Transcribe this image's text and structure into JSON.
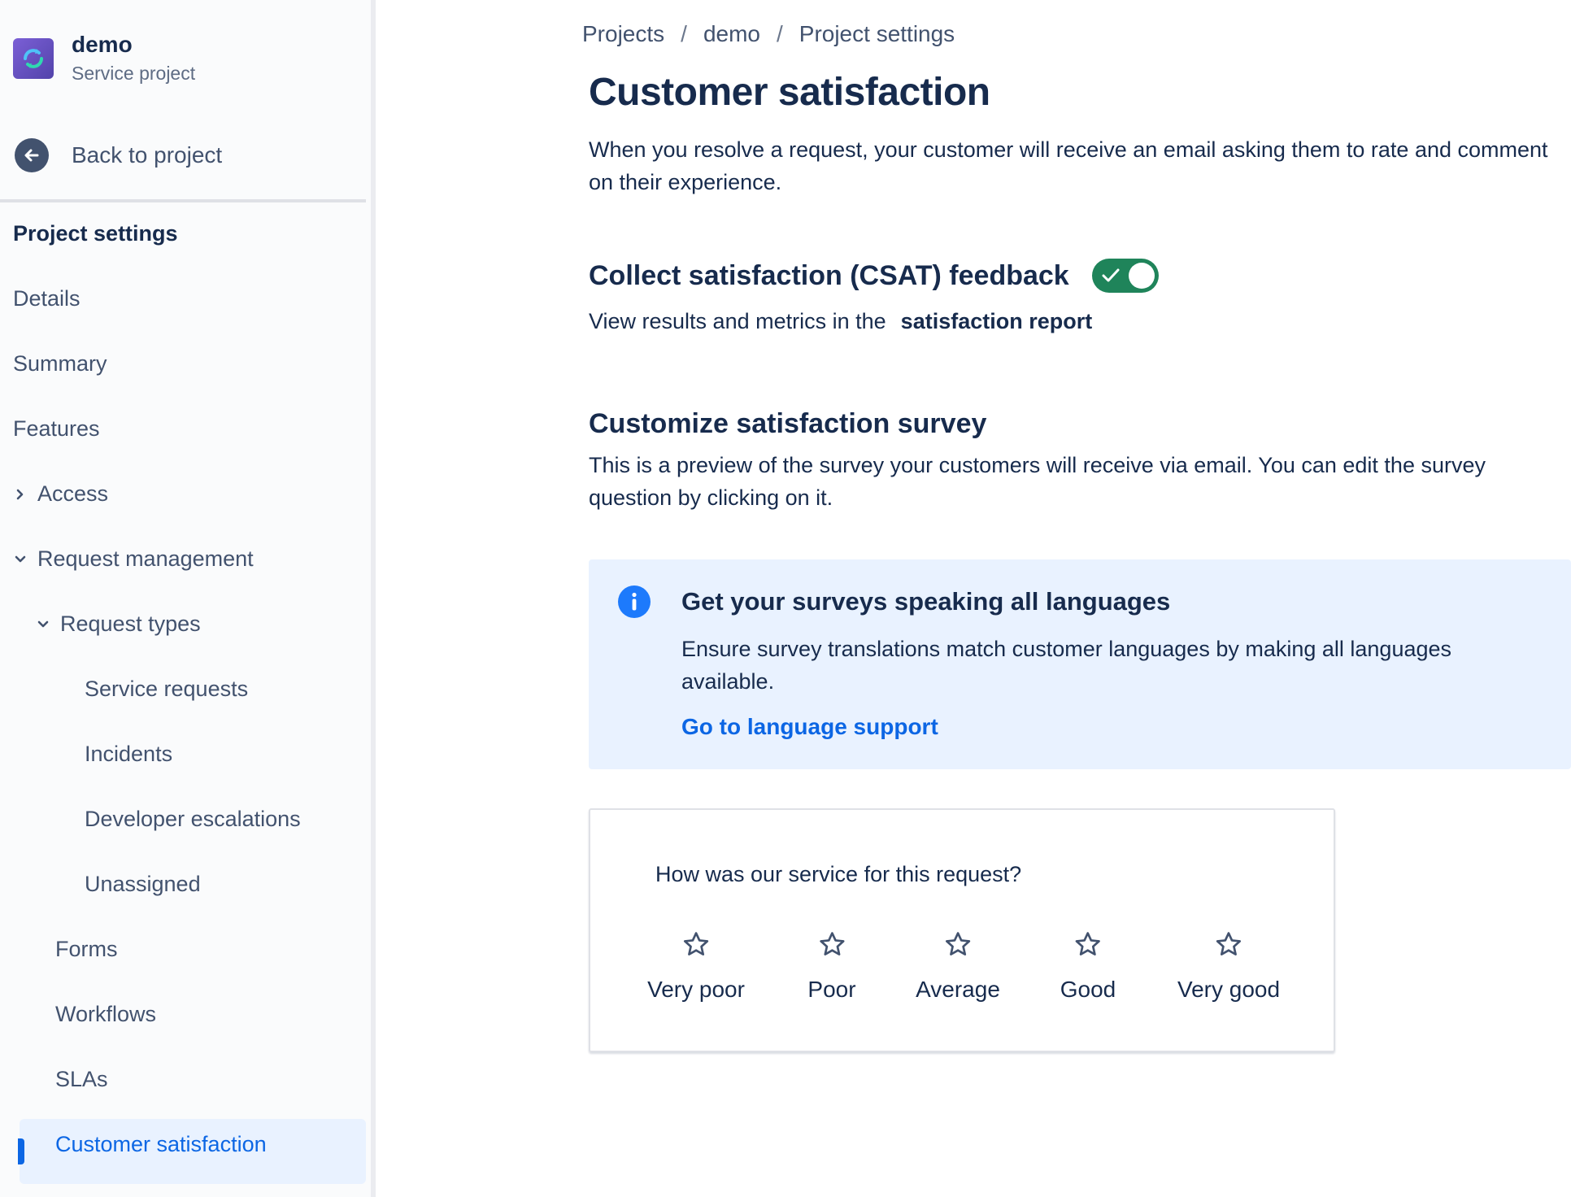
{
  "project": {
    "name": "demo",
    "type": "Service project",
    "avatar_icon": "service-project-avatar-icon"
  },
  "sidebar": {
    "back_label": "Back to project",
    "heading": "Project settings",
    "items": [
      {
        "label": "Details"
      },
      {
        "label": "Summary"
      },
      {
        "label": "Features"
      },
      {
        "label": "Access",
        "icon": "chevron-right-icon",
        "expanded": false
      },
      {
        "label": "Request management",
        "icon": "chevron-down-icon",
        "expanded": true
      },
      {
        "label": "Request types",
        "icon": "chevron-down-icon",
        "expanded": true
      },
      {
        "label": "Service requests"
      },
      {
        "label": "Incidents"
      },
      {
        "label": "Developer escalations"
      },
      {
        "label": "Unassigned"
      },
      {
        "label": "Forms"
      },
      {
        "label": "Workflows"
      },
      {
        "label": "SLAs"
      },
      {
        "label": "Customer satisfaction",
        "active": true
      }
    ]
  },
  "breadcrumb": {
    "items": [
      "Projects",
      "demo",
      "Project settings"
    ],
    "separator": "/"
  },
  "main": {
    "title": "Customer satisfaction",
    "intro": "When you resolve a request, your customer will receive an email asking them to rate and comment on their experience.",
    "csat": {
      "title": "Collect satisfaction (CSAT) feedback",
      "enabled": true,
      "report_prefix": "View results and metrics in the",
      "report_link": "satisfaction report"
    },
    "survey": {
      "title": "Customize satisfaction survey",
      "description": "This is a preview of the survey your customers will receive via email. You can edit the survey question by clicking on it."
    },
    "info": {
      "icon": "info-icon",
      "title": "Get your surveys speaking all languages",
      "body": "Ensure survey translations match customer languages by making all languages available.",
      "link": "Go to language support"
    },
    "preview": {
      "question": "How was our service for this request?",
      "ratings": [
        "Very poor",
        "Poor",
        "Average",
        "Good",
        "Very good"
      ]
    }
  },
  "colors": {
    "accent": "#0c66e4",
    "toggle_on": "#1f845a",
    "info_bg": "#e9f2ff",
    "text": "#172b4d",
    "subtle_text": "#42526e"
  }
}
